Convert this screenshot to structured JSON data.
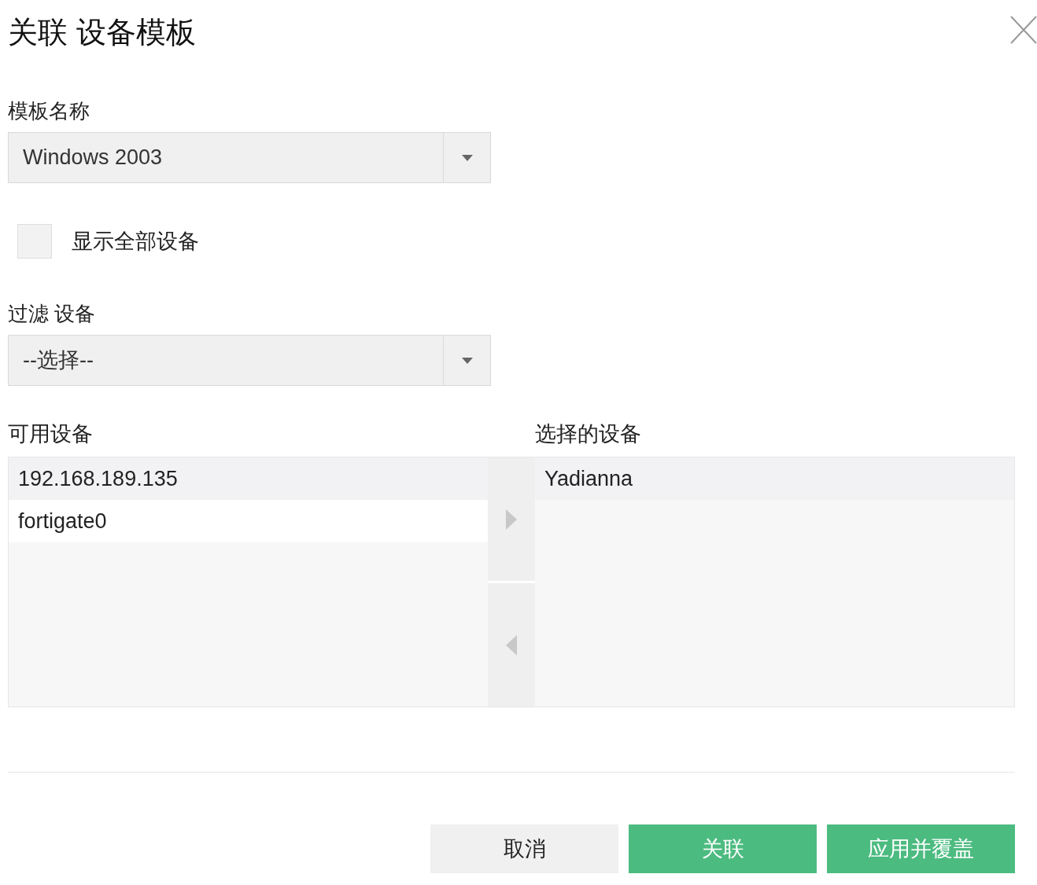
{
  "dialog": {
    "title": "关联 设备模板"
  },
  "template_field": {
    "label": "模板名称",
    "value": "Windows 2003"
  },
  "show_all": {
    "label": "显示全部设备",
    "checked": false
  },
  "filter_field": {
    "label": "过滤 设备",
    "value": "--选择--"
  },
  "available": {
    "label": "可用设备",
    "items": [
      {
        "text": "192.168.189.135",
        "selected": false
      },
      {
        "text": "fortigate0",
        "selected": true
      }
    ]
  },
  "chosen": {
    "label": "选择的设备",
    "items": [
      {
        "text": "Yadianna",
        "selected": false
      }
    ]
  },
  "buttons": [
    {
      "label": "取消",
      "kind": "secondary"
    },
    {
      "label": "关联",
      "kind": "primary"
    },
    {
      "label": "应用并覆盖",
      "kind": "primary"
    }
  ]
}
